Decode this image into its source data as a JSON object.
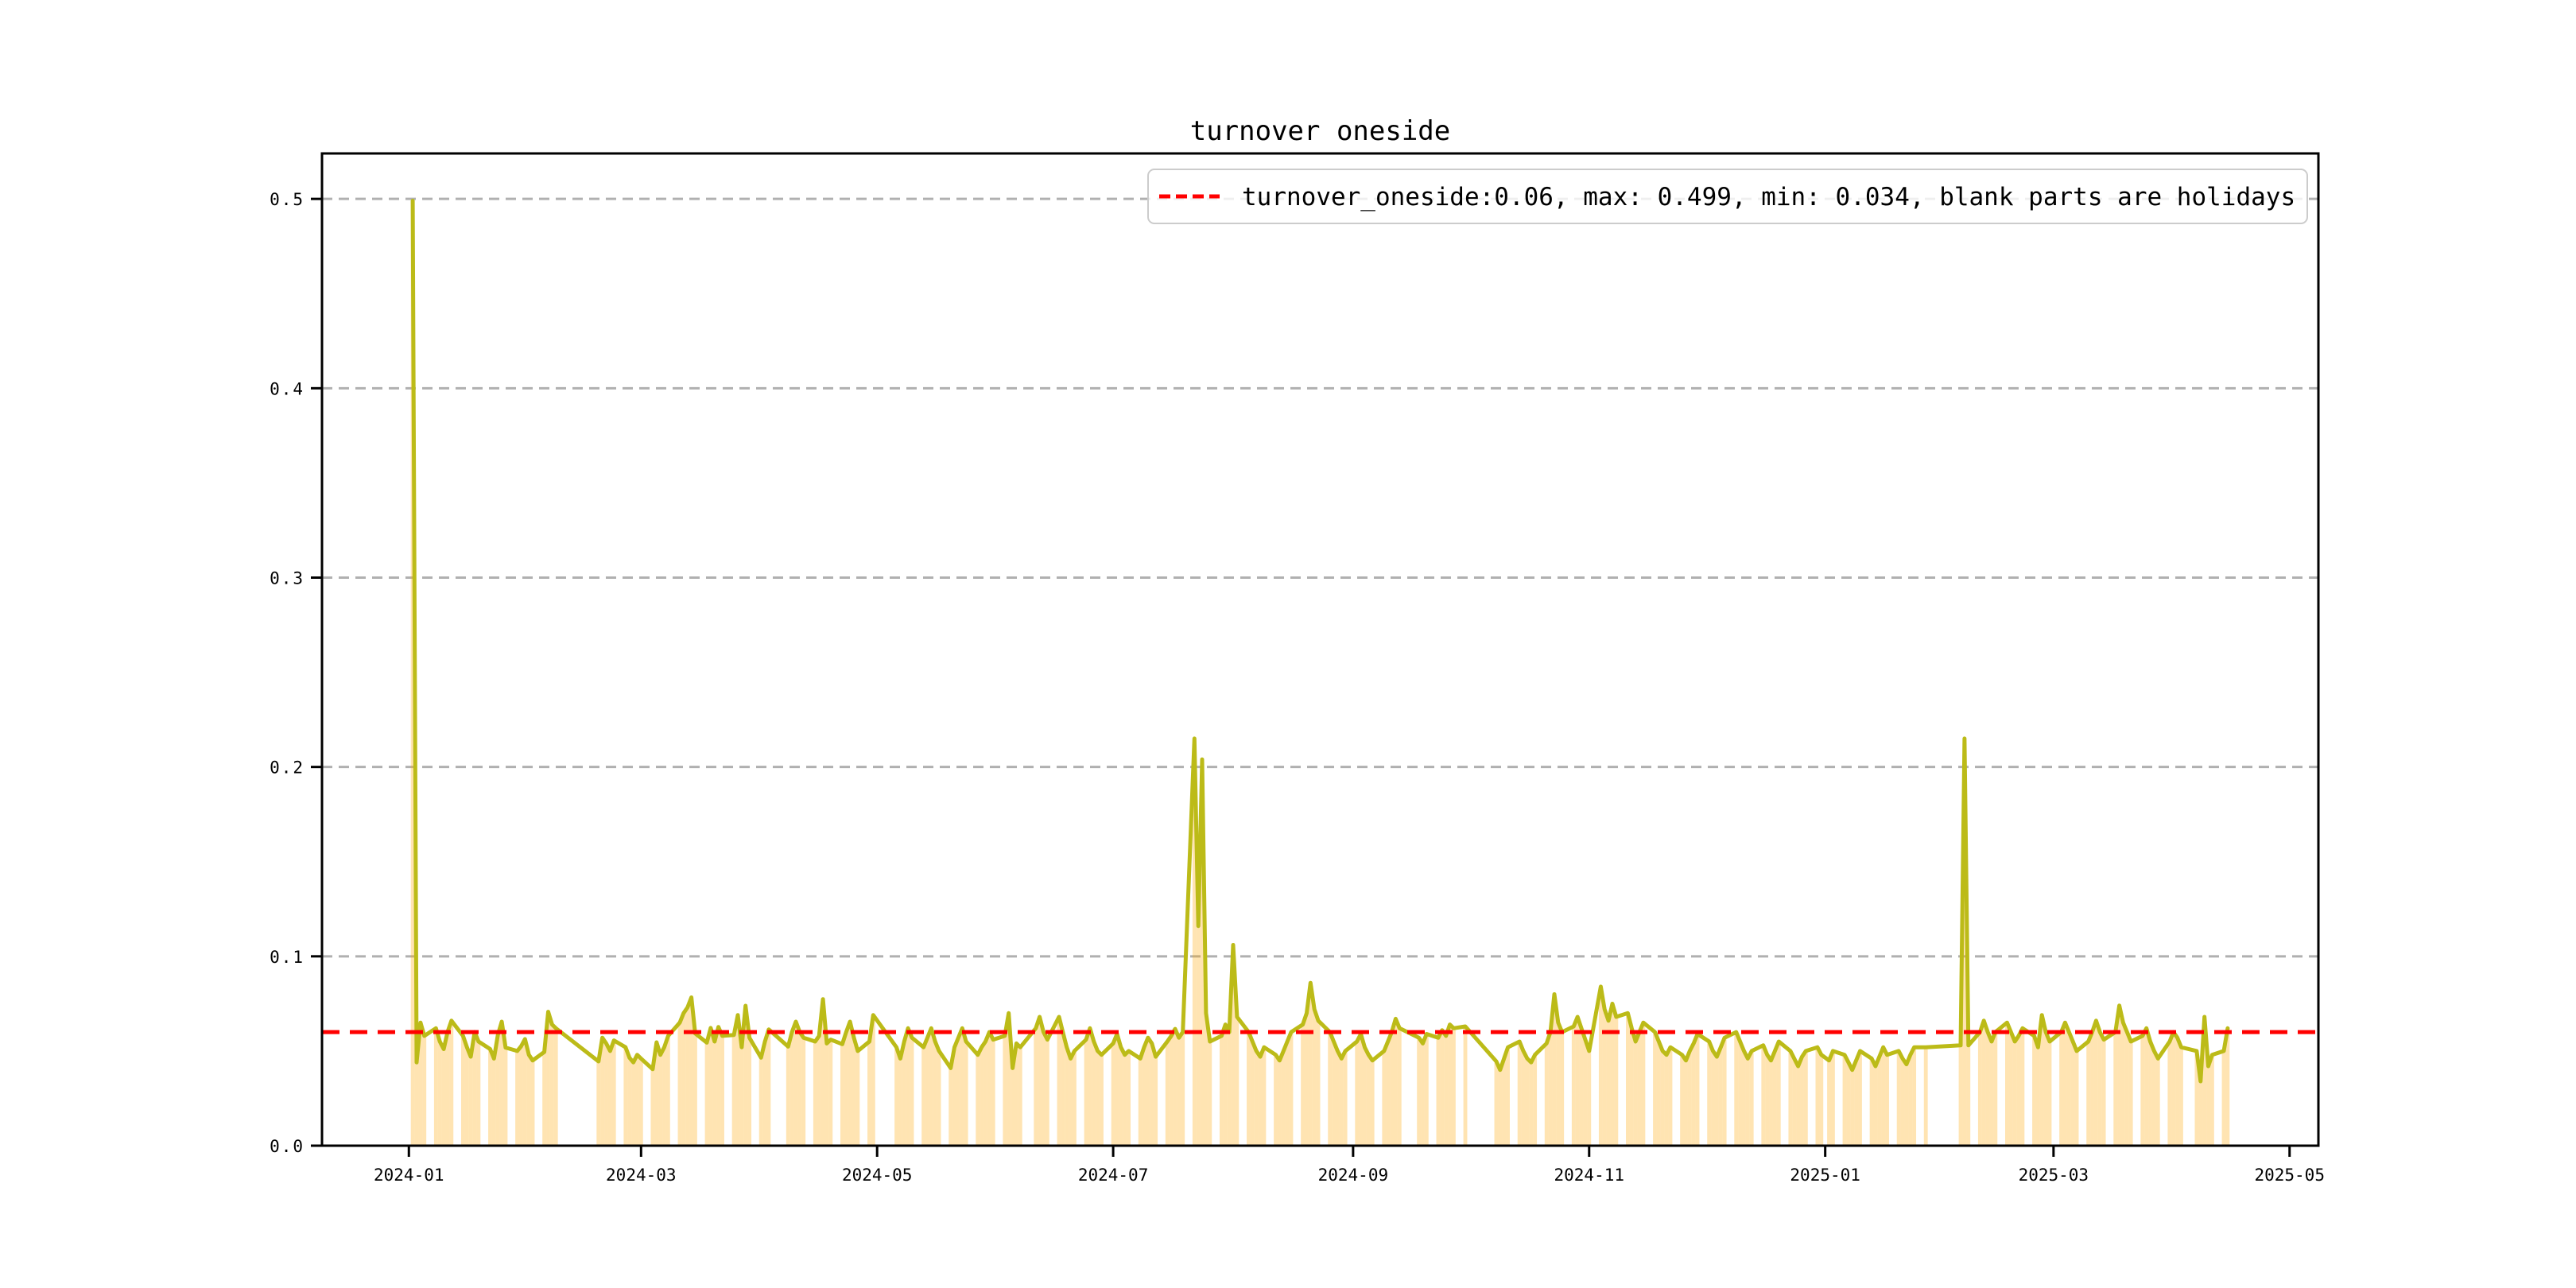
{
  "figure": {
    "title": "turnover oneside",
    "background": "#ffffff"
  },
  "legend": {
    "label": "turnover_oneside:0.06, max: 0.499, min: 0.034, blank parts are holidays",
    "sample_line_color": "#ff0000",
    "border_color": "#cccccc",
    "background": "rgba(255,255,255,0.8)"
  },
  "axes": {
    "y_ticks": [
      {
        "label": "0.0",
        "value": 0.0
      },
      {
        "label": "0.1",
        "value": 0.1
      },
      {
        "label": "0.2",
        "value": 0.2
      },
      {
        "label": "0.3",
        "value": 0.3
      },
      {
        "label": "0.4",
        "value": 0.4
      },
      {
        "label": "0.5",
        "value": 0.5
      }
    ],
    "x_ticks": [
      {
        "label": "2024-01",
        "date": "2024-01-01"
      },
      {
        "label": "2024-03",
        "date": "2024-03-01"
      },
      {
        "label": "2024-05",
        "date": "2024-05-01"
      },
      {
        "label": "2024-07",
        "date": "2024-07-01"
      },
      {
        "label": "2024-09",
        "date": "2024-09-01"
      },
      {
        "label": "2024-11",
        "date": "2024-11-01"
      },
      {
        "label": "2025-01",
        "date": "2025-01-01"
      },
      {
        "label": "2025-03",
        "date": "2025-03-01"
      },
      {
        "label": "2025-05",
        "date": "2025-05-01"
      }
    ],
    "grid_color": "#b0b0b0",
    "spine_color": "#000000"
  },
  "chart_data": {
    "type": "line",
    "title": "turnover oneside",
    "xlabel": "",
    "ylabel": "",
    "xlim": [
      "2023-12-09",
      "2025-05-09"
    ],
    "ylim": [
      0.0,
      0.524
    ],
    "grid": true,
    "legend_position": "upper right",
    "average_line": {
      "value": 0.06,
      "color": "#ff0000",
      "style": "dashed"
    },
    "stats": {
      "mean": 0.06,
      "max": 0.499,
      "min": 0.034
    },
    "line_color": "#bcbb18",
    "fill_color": "rgba(255,165,0,0.3)",
    "note": "orange fill marks trading days; blank parts are holidays",
    "series_name": "turnover_oneside",
    "points": [
      [
        "2024-01-02",
        0.499
      ],
      [
        "2024-01-03",
        0.044
      ],
      [
        "2024-01-04",
        0.065
      ],
      [
        "2024-01-05",
        0.058
      ],
      [
        "2024-01-08",
        0.062
      ],
      [
        "2024-01-09",
        0.055
      ],
      [
        "2024-01-10",
        0.051
      ],
      [
        "2024-01-11",
        0.06
      ],
      [
        "2024-01-12",
        0.066
      ],
      [
        "2024-01-15",
        0.058
      ],
      [
        "2024-01-16",
        0.052
      ],
      [
        "2024-01-17",
        0.047
      ],
      [
        "2024-01-18",
        0.06
      ],
      [
        "2024-01-19",
        0.055
      ],
      [
        "2024-01-22",
        0.051
      ],
      [
        "2024-01-23",
        0.046
      ],
      [
        "2024-01-24",
        0.0585
      ],
      [
        "2024-01-25",
        0.0655
      ],
      [
        "2024-01-26",
        0.0518
      ],
      [
        "2024-01-29",
        0.05
      ],
      [
        "2024-01-30",
        0.0525
      ],
      [
        "2024-01-31",
        0.0563
      ],
      [
        "2024-02-01",
        0.048
      ],
      [
        "2024-02-02",
        0.045
      ],
      [
        "2024-02-05",
        0.0495
      ],
      [
        "2024-02-06",
        0.0707
      ],
      [
        "2024-02-07",
        0.064
      ],
      [
        "2024-02-08",
        0.062
      ],
      [
        "2024-02-19",
        0.0445
      ],
      [
        "2024-02-20",
        0.057
      ],
      [
        "2024-02-21",
        0.054
      ],
      [
        "2024-02-22",
        0.05
      ],
      [
        "2024-02-23",
        0.0556
      ],
      [
        "2024-02-26",
        0.052
      ],
      [
        "2024-02-27",
        0.0465
      ],
      [
        "2024-02-28",
        0.044
      ],
      [
        "2024-02-29",
        0.048
      ],
      [
        "2024-03-01",
        0.046
      ],
      [
        "2024-03-04",
        0.0404
      ],
      [
        "2024-03-05",
        0.0546
      ],
      [
        "2024-03-06",
        0.048
      ],
      [
        "2024-03-07",
        0.052
      ],
      [
        "2024-03-08",
        0.058
      ],
      [
        "2024-03-11",
        0.065
      ],
      [
        "2024-03-12",
        0.07
      ],
      [
        "2024-03-13",
        0.073
      ],
      [
        "2024-03-14",
        0.0783
      ],
      [
        "2024-03-15",
        0.0593
      ],
      [
        "2024-03-18",
        0.0544
      ],
      [
        "2024-03-19",
        0.0622
      ],
      [
        "2024-03-20",
        0.055
      ],
      [
        "2024-03-21",
        0.0627
      ],
      [
        "2024-03-22",
        0.058
      ],
      [
        "2024-03-25",
        0.0585
      ],
      [
        "2024-03-26",
        0.069
      ],
      [
        "2024-03-27",
        0.052
      ],
      [
        "2024-03-28",
        0.0739
      ],
      [
        "2024-03-29",
        0.057
      ],
      [
        "2024-04-01",
        0.0465
      ],
      [
        "2024-04-02",
        0.055
      ],
      [
        "2024-04-03",
        0.0614
      ],
      [
        "2024-04-08",
        0.0523
      ],
      [
        "2024-04-09",
        0.06
      ],
      [
        "2024-04-10",
        0.0655
      ],
      [
        "2024-04-11",
        0.06
      ],
      [
        "2024-04-12",
        0.057
      ],
      [
        "2024-04-15",
        0.055
      ],
      [
        "2024-04-16",
        0.058
      ],
      [
        "2024-04-17",
        0.0774
      ],
      [
        "2024-04-18",
        0.054
      ],
      [
        "2024-04-19",
        0.056
      ],
      [
        "2024-04-22",
        0.0536
      ],
      [
        "2024-04-23",
        0.06
      ],
      [
        "2024-04-24",
        0.0655
      ],
      [
        "2024-04-25",
        0.057
      ],
      [
        "2024-04-26",
        0.05
      ],
      [
        "2024-04-29",
        0.055
      ],
      [
        "2024-04-30",
        0.069
      ],
      [
        "2024-05-06",
        0.052
      ],
      [
        "2024-05-07",
        0.046
      ],
      [
        "2024-05-08",
        0.055
      ],
      [
        "2024-05-09",
        0.062
      ],
      [
        "2024-05-10",
        0.057
      ],
      [
        "2024-05-13",
        0.052
      ],
      [
        "2024-05-14",
        0.057
      ],
      [
        "2024-05-15",
        0.062
      ],
      [
        "2024-05-16",
        0.055
      ],
      [
        "2024-05-17",
        0.05
      ],
      [
        "2024-05-20",
        0.041
      ],
      [
        "2024-05-21",
        0.052
      ],
      [
        "2024-05-22",
        0.057
      ],
      [
        "2024-05-23",
        0.062
      ],
      [
        "2024-05-24",
        0.055
      ],
      [
        "2024-05-27",
        0.048
      ],
      [
        "2024-05-28",
        0.052
      ],
      [
        "2024-05-29",
        0.055
      ],
      [
        "2024-05-30",
        0.06
      ],
      [
        "2024-05-31",
        0.056
      ],
      [
        "2024-06-03",
        0.058
      ],
      [
        "2024-06-04",
        0.07
      ],
      [
        "2024-06-05",
        0.041
      ],
      [
        "2024-06-06",
        0.054
      ],
      [
        "2024-06-07",
        0.052
      ],
      [
        "2024-06-11",
        0.062
      ],
      [
        "2024-06-12",
        0.068
      ],
      [
        "2024-06-13",
        0.06
      ],
      [
        "2024-06-14",
        0.056
      ],
      [
        "2024-06-17",
        0.068
      ],
      [
        "2024-06-18",
        0.06
      ],
      [
        "2024-06-19",
        0.052
      ],
      [
        "2024-06-20",
        0.046
      ],
      [
        "2024-06-21",
        0.05
      ],
      [
        "2024-06-24",
        0.056
      ],
      [
        "2024-06-25",
        0.062
      ],
      [
        "2024-06-26",
        0.055
      ],
      [
        "2024-06-27",
        0.05
      ],
      [
        "2024-06-28",
        0.048
      ],
      [
        "2024-07-01",
        0.054
      ],
      [
        "2024-07-02",
        0.059
      ],
      [
        "2024-07-03",
        0.052
      ],
      [
        "2024-07-04",
        0.048
      ],
      [
        "2024-07-05",
        0.05
      ],
      [
        "2024-07-08",
        0.046
      ],
      [
        "2024-07-09",
        0.052
      ],
      [
        "2024-07-10",
        0.057
      ],
      [
        "2024-07-11",
        0.054
      ],
      [
        "2024-07-12",
        0.047
      ],
      [
        "2024-07-15",
        0.055
      ],
      [
        "2024-07-16",
        0.058
      ],
      [
        "2024-07-17",
        0.0617
      ],
      [
        "2024-07-18",
        0.057
      ],
      [
        "2024-07-19",
        0.06
      ],
      [
        "2024-07-22",
        0.215
      ],
      [
        "2024-07-23",
        0.116
      ],
      [
        "2024-07-24",
        0.204
      ],
      [
        "2024-07-25",
        0.07
      ],
      [
        "2024-07-26",
        0.055
      ],
      [
        "2024-07-29",
        0.058
      ],
      [
        "2024-07-30",
        0.064
      ],
      [
        "2024-07-31",
        0.06
      ],
      [
        "2024-08-01",
        0.106
      ],
      [
        "2024-08-02",
        0.068
      ],
      [
        "2024-08-05",
        0.06
      ],
      [
        "2024-08-06",
        0.055
      ],
      [
        "2024-08-07",
        0.05
      ],
      [
        "2024-08-08",
        0.047
      ],
      [
        "2024-08-09",
        0.052
      ],
      [
        "2024-08-12",
        0.048
      ],
      [
        "2024-08-13",
        0.045
      ],
      [
        "2024-08-14",
        0.05
      ],
      [
        "2024-08-15",
        0.055
      ],
      [
        "2024-08-16",
        0.06
      ],
      [
        "2024-08-19",
        0.064
      ],
      [
        "2024-08-20",
        0.07
      ],
      [
        "2024-08-21",
        0.086
      ],
      [
        "2024-08-22",
        0.072
      ],
      [
        "2024-08-23",
        0.066
      ],
      [
        "2024-08-26",
        0.06
      ],
      [
        "2024-08-27",
        0.055
      ],
      [
        "2024-08-28",
        0.05
      ],
      [
        "2024-08-29",
        0.046
      ],
      [
        "2024-08-30",
        0.05
      ],
      [
        "2024-09-02",
        0.055
      ],
      [
        "2024-09-03",
        0.059
      ],
      [
        "2024-09-04",
        0.052
      ],
      [
        "2024-09-05",
        0.048
      ],
      [
        "2024-09-06",
        0.045
      ],
      [
        "2024-09-09",
        0.05
      ],
      [
        "2024-09-10",
        0.055
      ],
      [
        "2024-09-11",
        0.06
      ],
      [
        "2024-09-12",
        0.067
      ],
      [
        "2024-09-13",
        0.062
      ],
      [
        "2024-09-18",
        0.057
      ],
      [
        "2024-09-19",
        0.054
      ],
      [
        "2024-09-20",
        0.059
      ],
      [
        "2024-09-23",
        0.057
      ],
      [
        "2024-09-24",
        0.061
      ],
      [
        "2024-09-25",
        0.058
      ],
      [
        "2024-09-26",
        0.064
      ],
      [
        "2024-09-27",
        0.062
      ],
      [
        "2024-09-30",
        0.063
      ],
      [
        "2024-10-08",
        0.0445
      ],
      [
        "2024-10-09",
        0.04
      ],
      [
        "2024-10-10",
        0.046
      ],
      [
        "2024-10-11",
        0.052
      ],
      [
        "2024-10-14",
        0.055
      ],
      [
        "2024-10-15",
        0.05
      ],
      [
        "2024-10-16",
        0.046
      ],
      [
        "2024-10-17",
        0.044
      ],
      [
        "2024-10-18",
        0.048
      ],
      [
        "2024-10-21",
        0.054
      ],
      [
        "2024-10-22",
        0.06
      ],
      [
        "2024-10-23",
        0.08
      ],
      [
        "2024-10-24",
        0.065
      ],
      [
        "2024-10-25",
        0.06
      ],
      [
        "2024-10-28",
        0.063
      ],
      [
        "2024-10-29",
        0.068
      ],
      [
        "2024-10-30",
        0.062
      ],
      [
        "2024-10-31",
        0.056
      ],
      [
        "2024-11-01",
        0.05
      ],
      [
        "2024-11-04",
        0.084
      ],
      [
        "2024-11-05",
        0.072
      ],
      [
        "2024-11-06",
        0.066
      ],
      [
        "2024-11-07",
        0.075
      ],
      [
        "2024-11-08",
        0.068
      ],
      [
        "2024-11-11",
        0.07
      ],
      [
        "2024-11-12",
        0.062
      ],
      [
        "2024-11-13",
        0.055
      ],
      [
        "2024-11-14",
        0.06
      ],
      [
        "2024-11-15",
        0.065
      ],
      [
        "2024-11-18",
        0.06
      ],
      [
        "2024-11-19",
        0.055
      ],
      [
        "2024-11-20",
        0.05
      ],
      [
        "2024-11-21",
        0.048
      ],
      [
        "2024-11-22",
        0.052
      ],
      [
        "2024-11-25",
        0.048
      ],
      [
        "2024-11-26",
        0.045
      ],
      [
        "2024-11-27",
        0.05
      ],
      [
        "2024-11-28",
        0.054
      ],
      [
        "2024-11-29",
        0.059
      ],
      [
        "2024-12-02",
        0.055
      ],
      [
        "2024-12-03",
        0.05
      ],
      [
        "2024-12-04",
        0.047
      ],
      [
        "2024-12-05",
        0.052
      ],
      [
        "2024-12-06",
        0.057
      ],
      [
        "2024-12-09",
        0.06
      ],
      [
        "2024-12-10",
        0.055
      ],
      [
        "2024-12-11",
        0.05
      ],
      [
        "2024-12-12",
        0.046
      ],
      [
        "2024-12-13",
        0.05
      ],
      [
        "2024-12-16",
        0.053
      ],
      [
        "2024-12-17",
        0.048
      ],
      [
        "2024-12-18",
        0.045
      ],
      [
        "2024-12-19",
        0.05
      ],
      [
        "2024-12-20",
        0.055
      ],
      [
        "2024-12-23",
        0.05
      ],
      [
        "2024-12-24",
        0.046
      ],
      [
        "2024-12-25",
        0.042
      ],
      [
        "2024-12-26",
        0.047
      ],
      [
        "2024-12-27",
        0.05
      ],
      [
        "2024-12-30",
        0.052
      ],
      [
        "2024-12-31",
        0.048
      ],
      [
        "2025-01-02",
        0.045
      ],
      [
        "2025-01-03",
        0.05
      ],
      [
        "2025-01-06",
        0.048
      ],
      [
        "2025-01-07",
        0.044
      ],
      [
        "2025-01-08",
        0.04
      ],
      [
        "2025-01-09",
        0.045
      ],
      [
        "2025-01-10",
        0.05
      ],
      [
        "2025-01-13",
        0.046
      ],
      [
        "2025-01-14",
        0.042
      ],
      [
        "2025-01-15",
        0.047
      ],
      [
        "2025-01-16",
        0.052
      ],
      [
        "2025-01-17",
        0.048
      ],
      [
        "2025-01-20",
        0.05
      ],
      [
        "2025-01-21",
        0.046
      ],
      [
        "2025-01-22",
        0.043
      ],
      [
        "2025-01-23",
        0.048
      ],
      [
        "2025-01-24",
        0.052
      ],
      [
        "2025-01-27",
        0.052
      ],
      [
        "2025-02-05",
        0.053
      ],
      [
        "2025-02-06",
        0.215
      ],
      [
        "2025-02-07",
        0.053
      ],
      [
        "2025-02-10",
        0.06
      ],
      [
        "2025-02-11",
        0.066
      ],
      [
        "2025-02-12",
        0.06
      ],
      [
        "2025-02-13",
        0.055
      ],
      [
        "2025-02-14",
        0.06
      ],
      [
        "2025-02-17",
        0.065
      ],
      [
        "2025-02-18",
        0.06
      ],
      [
        "2025-02-19",
        0.055
      ],
      [
        "2025-02-20",
        0.058
      ],
      [
        "2025-02-21",
        0.062
      ],
      [
        "2025-02-24",
        0.058
      ],
      [
        "2025-02-25",
        0.052
      ],
      [
        "2025-02-26",
        0.069
      ],
      [
        "2025-02-27",
        0.06
      ],
      [
        "2025-02-28",
        0.055
      ],
      [
        "2025-03-03",
        0.06
      ],
      [
        "2025-03-04",
        0.065
      ],
      [
        "2025-03-05",
        0.06
      ],
      [
        "2025-03-06",
        0.055
      ],
      [
        "2025-03-07",
        0.05
      ],
      [
        "2025-03-10",
        0.055
      ],
      [
        "2025-03-11",
        0.06
      ],
      [
        "2025-03-12",
        0.066
      ],
      [
        "2025-03-13",
        0.06
      ],
      [
        "2025-03-14",
        0.056
      ],
      [
        "2025-03-17",
        0.06
      ],
      [
        "2025-03-18",
        0.074
      ],
      [
        "2025-03-19",
        0.065
      ],
      [
        "2025-03-20",
        0.06
      ],
      [
        "2025-03-21",
        0.055
      ],
      [
        "2025-03-24",
        0.058
      ],
      [
        "2025-03-25",
        0.062
      ],
      [
        "2025-03-26",
        0.055
      ],
      [
        "2025-03-27",
        0.05
      ],
      [
        "2025-03-28",
        0.046
      ],
      [
        "2025-03-31",
        0.055
      ],
      [
        "2025-04-01",
        0.06
      ],
      [
        "2025-04-02",
        0.057
      ],
      [
        "2025-04-03",
        0.052
      ],
      [
        "2025-04-07",
        0.05
      ],
      [
        "2025-04-08",
        0.034
      ],
      [
        "2025-04-09",
        0.068
      ],
      [
        "2025-04-10",
        0.042
      ],
      [
        "2025-04-11",
        0.048
      ],
      [
        "2025-04-14",
        0.05
      ],
      [
        "2025-04-15",
        0.062
      ]
    ]
  }
}
